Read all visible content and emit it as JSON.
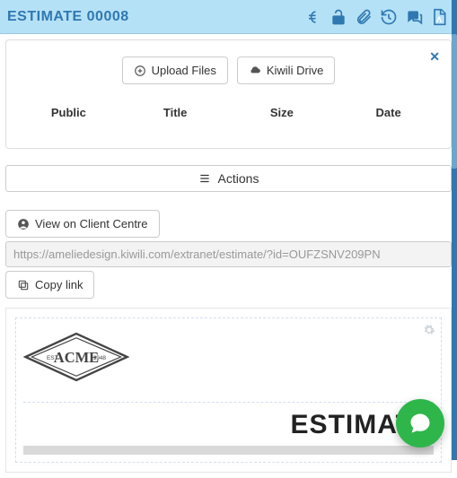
{
  "header": {
    "title": "ESTIMATE 00008"
  },
  "upload": {
    "upload_label": "Upload Files",
    "drive_label": "Kiwili Drive",
    "columns": {
      "public": "Public",
      "title": "Title",
      "size": "Size",
      "date": "Date"
    }
  },
  "actions_label": "Actions",
  "client_centre": {
    "view_label": "View on Client Centre",
    "url": "https://ameliedesign.kiwili.com/extranet/estimate/?id=OUFZSNV209PN",
    "copy_label": "Copy link"
  },
  "preview": {
    "logo_est": "EST.",
    "logo_name": "ACME",
    "logo_year": "1948",
    "doc_title": "ESTIMATE"
  }
}
